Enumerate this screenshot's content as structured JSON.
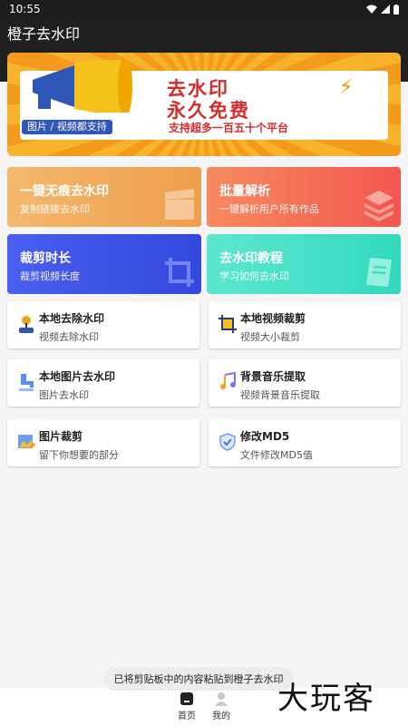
{
  "status_bar": {
    "time": "10:55",
    "icons": [
      "wifi-icon",
      "signal-icon",
      "battery-icon"
    ]
  },
  "app_bar": {
    "title": "橙子去水印"
  },
  "banner": {
    "pill": "图片 / 视频都支持",
    "title_line1": "去水印",
    "title_line2": "永久免费",
    "subtitle": "支持超多一百五十个平台"
  },
  "cards": [
    {
      "title": "一键无痕去水印",
      "subtitle": "复制链接去水印",
      "icon": "clapperboard-icon",
      "color": "#f0a85a"
    },
    {
      "title": "批量解析",
      "subtitle": "一键解析用户所有作品",
      "icon": "layers-icon",
      "color": "#f46b5d"
    },
    {
      "title": "裁剪时长",
      "subtitle": "裁剪视频长度",
      "icon": "crop-icon",
      "color": "#3d56e6"
    },
    {
      "title": "去水印教程",
      "subtitle": "学习如何去水印",
      "icon": "book-icon",
      "color": "#43dfc3"
    }
  ],
  "tiles": [
    {
      "title": "本地去除水印",
      "subtitle": "视频去除水印",
      "icon": "joystick-icon"
    },
    {
      "title": "本地视频裁剪",
      "subtitle": "视频大小裁剪",
      "icon": "crop-frame-icon"
    },
    {
      "title": "本地图片去水印",
      "subtitle": "图片去水印",
      "icon": "faucet-icon"
    },
    {
      "title": "背景音乐提取",
      "subtitle": "视频背景音乐提取",
      "icon": "music-note-icon"
    },
    {
      "title": "图片裁剪",
      "subtitle": "留下你想要的部分",
      "icon": "image-edit-icon"
    },
    {
      "title": "修改MD5",
      "subtitle": "文件修改MD5值",
      "icon": "shield-icon"
    }
  ],
  "toast": {
    "text": "已将剪贴板中的内容粘贴到橙子去水印"
  },
  "tab_bar": {
    "home_label": "首页",
    "mine_label": "我的"
  },
  "watermark": {
    "text": "大玩客"
  }
}
